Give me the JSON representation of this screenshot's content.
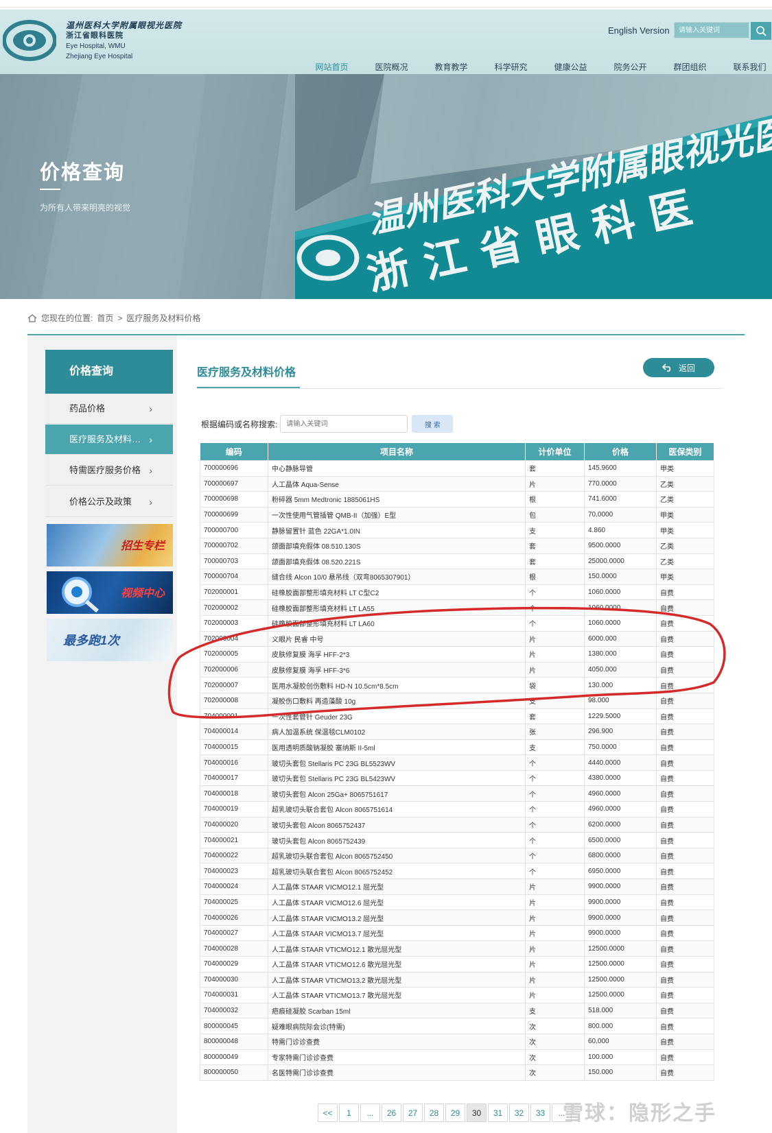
{
  "header": {
    "logo_lines": [
      "温州医科大学附属眼视光医院",
      "浙江省眼科医院",
      "Eye Hospital, WMU",
      "Zhejiang Eye Hospital"
    ],
    "english_version": "English Version",
    "search_placeholder": "请输入关键词",
    "nav": [
      "网站首页",
      "医院概况",
      "教育教学",
      "科学研究",
      "健康公益",
      "院务公开",
      "群团组织",
      "联系我们"
    ]
  },
  "banner": {
    "title": "价格查询",
    "subtitle": "为所有人带来明亮的视觉",
    "sign_line1": "温州医科大学附属眼视光医",
    "sign_line2": "浙江省眼科医"
  },
  "breadcrumb": {
    "prefix": "您现在的位置:",
    "home": "首页",
    "sep": ">",
    "current": "医疗服务及材料价格"
  },
  "sidebar": {
    "title": "价格查询",
    "items": [
      "药品价格",
      "医疗服务及材料…",
      "特需医疗服务价格",
      "价格公示及政策"
    ],
    "promos": [
      "招生专栏",
      "视频中心",
      "最多跑1次"
    ]
  },
  "content": {
    "title": "医疗服务及材料价格",
    "back_label": "返回",
    "search_label": "根据编码或名称搜索:",
    "search_placeholder": "请输入关键词",
    "search_button": "搜 索"
  },
  "table": {
    "headers": [
      "编码",
      "项目名称",
      "计价单位",
      "价格",
      "医保类别"
    ],
    "rows": [
      [
        "700000696",
        "中心静脉导管",
        "套",
        "145.9600",
        "甲类"
      ],
      [
        "700000697",
        "人工晶体 Aqua-Sense",
        "片",
        "770.0000",
        "乙类"
      ],
      [
        "700000698",
        "粉碎器 5mm Medtronic 1885061HS",
        "根",
        "741.6000",
        "乙类"
      ],
      [
        "700000699",
        "一次性使用气管插管 QMB-II（加强）E型",
        "包",
        "70.0000",
        "甲类"
      ],
      [
        "700000700",
        "静脉留置针 蓝色 22GA*1.0IN",
        "支",
        "4.860",
        "甲类"
      ],
      [
        "700000702",
        "颌面部填充假体 08.510.130S",
        "套",
        "9500.0000",
        "乙类"
      ],
      [
        "700000703",
        "颌面部填充假体 08.520.221S",
        "套",
        "25000.0000",
        "乙类"
      ],
      [
        "700000704",
        "缝合线 Alcon 10/0 悬吊线（双弯8065307901）",
        "根",
        "150.0000",
        "甲类"
      ],
      [
        "702000001",
        "硅橡胶面部整形填充材料 LT C型C2",
        "个",
        "1060.0000",
        "自费"
      ],
      [
        "702000002",
        "硅橡胶面部整形填充材料 LT LA55",
        "个",
        "1060.0000",
        "自费"
      ],
      [
        "702000003",
        "硅橡胶面部整形填充材料 LT LA60",
        "个",
        "1060.0000",
        "自费"
      ],
      [
        "702000004",
        "义眼片 民睿 中号",
        "片",
        "6000.000",
        "自费"
      ],
      [
        "702000005",
        "皮肤修复膜 海孚 HFF-2*3",
        "片",
        "1380.000",
        "自费"
      ],
      [
        "702000006",
        "皮肤修复膜 海孚 HFF-3*6",
        "片",
        "4050.000",
        "自费"
      ],
      [
        "702000007",
        "医用水凝胶创伤敷料 HD-N 10.5cm*8.5cm",
        "袋",
        "130.000",
        "自费"
      ],
      [
        "702000008",
        "凝胶伤口敷料 再造藻酸 10g",
        "支",
        "98.000",
        "自费"
      ],
      [
        "704000001",
        "一次性套管针 Geuder 23G",
        "套",
        "1229.5000",
        "自费"
      ],
      [
        "704000014",
        "病人加温系统 保温毯CLM0102",
        "张",
        "296.900",
        "自费"
      ],
      [
        "704000015",
        "医用透明质酸钠凝胶 塞纳斯 II-5ml",
        "支",
        "750.0000",
        "自费"
      ],
      [
        "704000016",
        "玻切头套包 Stellaris PC 23G BL5523WV",
        "个",
        "4440.0000",
        "自费"
      ],
      [
        "704000017",
        "玻切头套包 Stellaris PC 23G BL5423WV",
        "个",
        "4380.0000",
        "自费"
      ],
      [
        "704000018",
        "玻切头套包 Alcon 25Ga+ 8065751617",
        "个",
        "4960.0000",
        "自费"
      ],
      [
        "704000019",
        "超乳玻切头联合套包 Alcon 8065751614",
        "个",
        "4960.0000",
        "自费"
      ],
      [
        "704000020",
        "玻切头套包 Alcon 8065752437",
        "个",
        "6200.0000",
        "自费"
      ],
      [
        "704000021",
        "玻切头套包 Alcon 8065752439",
        "个",
        "6500.0000",
        "自费"
      ],
      [
        "704000022",
        "超乳玻切头联合套包 Alcon 8065752450",
        "个",
        "6800.0000",
        "自费"
      ],
      [
        "704000023",
        "超乳玻切头联合套包 Alcon 8065752452",
        "个",
        "6950.0000",
        "自费"
      ],
      [
        "704000024",
        "人工晶体 STAAR VICMO12.1 屈光型",
        "片",
        "9900.0000",
        "自费"
      ],
      [
        "704000025",
        "人工晶体 STAAR VICMO12.6 屈光型",
        "片",
        "9900.0000",
        "自费"
      ],
      [
        "704000026",
        "人工晶体 STAAR VICMO13.2 屈光型",
        "片",
        "9900.0000",
        "自费"
      ],
      [
        "704000027",
        "人工晶体 STAAR VICMO13.7 屈光型",
        "片",
        "9900.0000",
        "自费"
      ],
      [
        "704000028",
        "人工晶体 STAAR VTICMO12.1 散光屈光型",
        "片",
        "12500.0000",
        "自费"
      ],
      [
        "704000029",
        "人工晶体 STAAR VTICMO12.6 散光屈光型",
        "片",
        "12500.0000",
        "自费"
      ],
      [
        "704000030",
        "人工晶体 STAAR VTICMO13.2 散光屈光型",
        "片",
        "12500.0000",
        "自费"
      ],
      [
        "704000031",
        "人工晶体 STAAR VTICMO13.7 散光屈光型",
        "片",
        "12500.0000",
        "自费"
      ],
      [
        "704000032",
        "疤痕硅凝胶 Scarban 15ml",
        "支",
        "518.000",
        "自费"
      ],
      [
        "800000045",
        "疑难眼病院际会诊(特需)",
        "次",
        "800.000",
        "自费"
      ],
      [
        "800000048",
        "特需门诊诊查费",
        "次",
        "60.000",
        "自费"
      ],
      [
        "800000049",
        "专家特需门诊诊查费",
        "次",
        "100.000",
        "自费"
      ],
      [
        "800000050",
        "名医特需门诊诊查费",
        "次",
        "150.000",
        "自费"
      ]
    ]
  },
  "pagination": [
    "<<",
    "1",
    "...",
    "26",
    "27",
    "28",
    "29",
    "30",
    "31",
    "32",
    "33",
    "..."
  ],
  "pagination_current": "30",
  "watermark": "雪球：隐形之手",
  "colors": {
    "accent": "#2e8c99",
    "accent_light": "#4ba5ae",
    "annotation": "#d42a2a"
  }
}
